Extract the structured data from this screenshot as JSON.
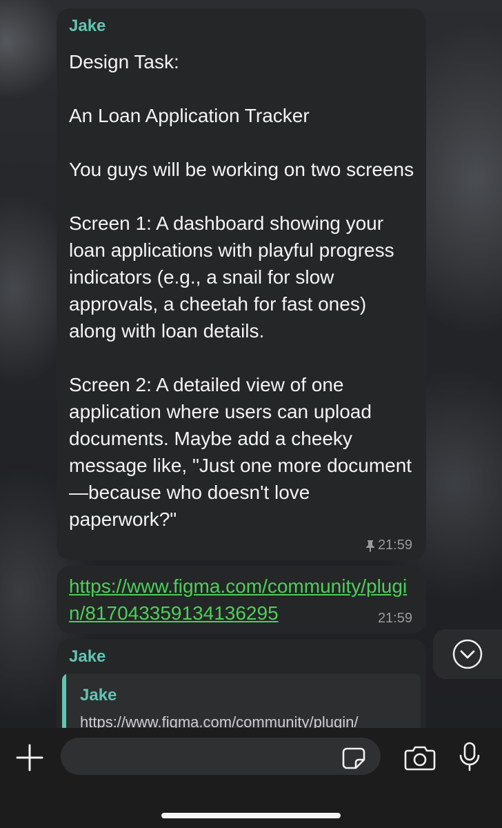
{
  "messages": [
    {
      "sender": "Jake",
      "text": "Design Task:\n\nAn Loan Application Tracker\n\nYou guys will be working on two screens\n\nScreen 1: A dashboard showing your loan applications with playful progress indicators (e.g., a snail for slow approvals, a cheetah for fast ones) along with loan details.\n\nScreen 2: A detailed view of one application where users can upload documents. Maybe add a cheeky message like, \"Just one more document—because who doesn't love paperwork?\"",
      "time": "21:59",
      "pinned": true
    },
    {
      "link": "https://www.figma.com/community/plugin/817043359134136295",
      "time": "21:59"
    },
    {
      "sender": "Jake",
      "reply": {
        "sender": "Jake",
        "text": "https://www.figma.com/community/plugin/"
      }
    }
  ],
  "composer": {
    "placeholder": "",
    "value": ""
  },
  "icons": {
    "pin": "pin-icon",
    "scroll_down": "chevron-down-icon",
    "add": "plus-icon",
    "sticker": "sticker-icon",
    "camera": "camera-icon",
    "mic": "microphone-icon"
  },
  "colors": {
    "accent": "#62c4b3",
    "link": "#4ccf5b",
    "bubble": "#252627"
  }
}
